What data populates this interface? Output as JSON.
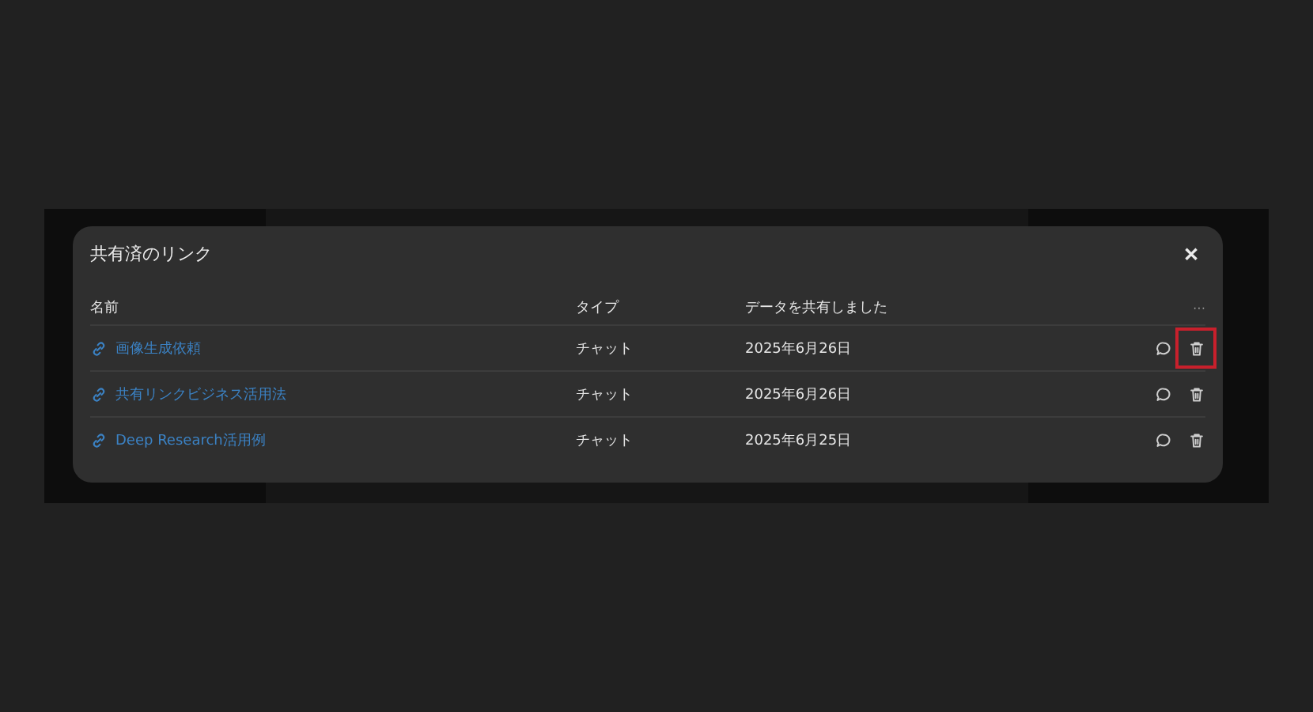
{
  "dialog": {
    "title": "共有済のリンク",
    "close": "✕"
  },
  "table": {
    "columns": [
      "名前",
      "タイプ",
      "データを共有しました"
    ],
    "more": "···",
    "rows": [
      {
        "name": "画像生成依頼",
        "type": "チャット",
        "date": "2025年6月26日",
        "highlighted": true
      },
      {
        "name": "共有リンクビジネス活用法",
        "type": "チャット",
        "date": "2025年6月26日",
        "highlighted": false
      },
      {
        "name": "Deep Research活用例",
        "type": "チャット",
        "date": "2025年6月25日",
        "highlighted": false
      }
    ]
  }
}
